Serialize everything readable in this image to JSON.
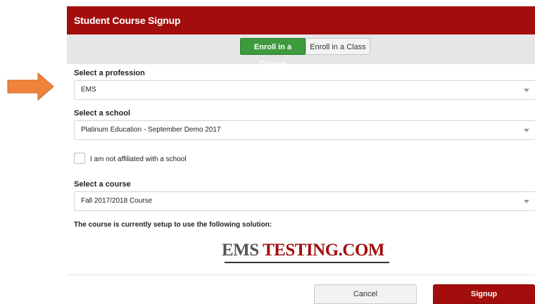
{
  "header": {
    "title": "Student Course Signup"
  },
  "tabs": [
    {
      "label": "Enroll in a Course",
      "active": true
    },
    {
      "label": "Enroll in a Class",
      "active": false
    }
  ],
  "profession": {
    "label": "Select a profession",
    "value": "EMS"
  },
  "school": {
    "label": "Select a school",
    "value": "Platinum Education - September Demo 2017"
  },
  "not_affiliated": {
    "label": "I am not affiliated with a school",
    "checked": false
  },
  "course": {
    "label": "Select a course",
    "value": "Fall 2017/2018 Course"
  },
  "solution_note": "The course is currently setup to use the following solution:",
  "logo": {
    "part1": "EMS",
    "part2": "TESTING.COM"
  },
  "buttons": {
    "cancel": "Cancel",
    "signup": "Signup"
  },
  "colors": {
    "brand_red": "#a30d0d",
    "tab_active_green": "#3d9a3d",
    "arrow_orange": "#f0833a"
  }
}
